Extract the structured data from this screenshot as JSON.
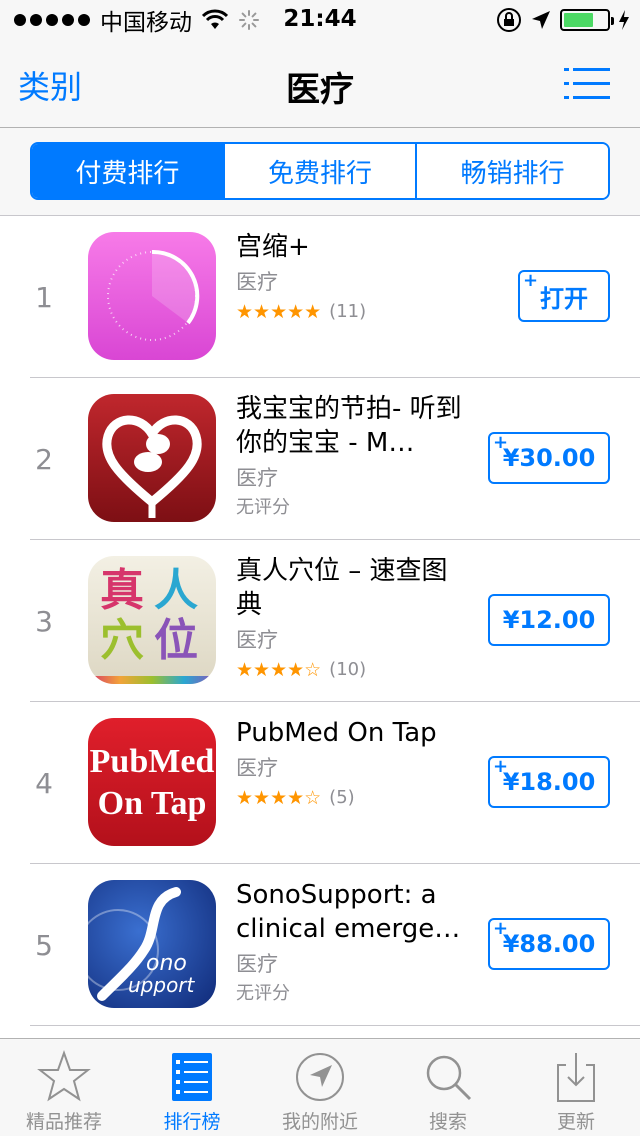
{
  "status_bar": {
    "carrier": "中国移动",
    "time": "21:44"
  },
  "nav": {
    "back_label": "类别",
    "title": "医疗"
  },
  "segments": [
    "付费排行",
    "免费排行",
    "畅销排行"
  ],
  "apps": [
    {
      "rank": "1",
      "name": "宫缩+",
      "category": "医疗",
      "stars": "★★★★★",
      "rating_count": "(11)",
      "button": "打开",
      "icon": "contraction-timer-icon"
    },
    {
      "rank": "2",
      "name": "我宝宝的节拍- 听到你的宝宝 - M…",
      "category": "医疗",
      "no_rating": "无评分",
      "button": "¥30.00",
      "icon": "baby-heartbeat-icon"
    },
    {
      "rank": "3",
      "name": "真人穴位 – 速查图典",
      "category": "医疗",
      "stars": "★★★★☆",
      "rating_count": "(10)",
      "button": "¥12.00",
      "icon": "acupoint-icon",
      "icon_text": [
        "真",
        "人",
        "穴",
        "位"
      ]
    },
    {
      "rank": "4",
      "name": "PubMed On Tap",
      "category": "医疗",
      "stars": "★★★★☆",
      "rating_count": "(5)",
      "button": "¥18.00",
      "icon": "pubmed-icon",
      "icon_text": [
        "PubMed",
        "On Tap"
      ]
    },
    {
      "rank": "5",
      "name": "SonoSupport: a clinical emerge…",
      "category": "医疗",
      "no_rating": "无评分",
      "button": "¥88.00",
      "icon": "sonosupport-icon",
      "icon_text": [
        "ono",
        "upport"
      ]
    }
  ],
  "tabs": [
    {
      "label": "精品推荐",
      "icon": "star-icon"
    },
    {
      "label": "排行榜",
      "icon": "ranking-list-icon"
    },
    {
      "label": "我的附近",
      "icon": "location-arrow-icon"
    },
    {
      "label": "搜索",
      "icon": "search-icon"
    },
    {
      "label": "更新",
      "icon": "download-icon"
    }
  ],
  "colors": {
    "accent": "#007aff",
    "star": "#ff9500",
    "battery": "#4cd964"
  }
}
